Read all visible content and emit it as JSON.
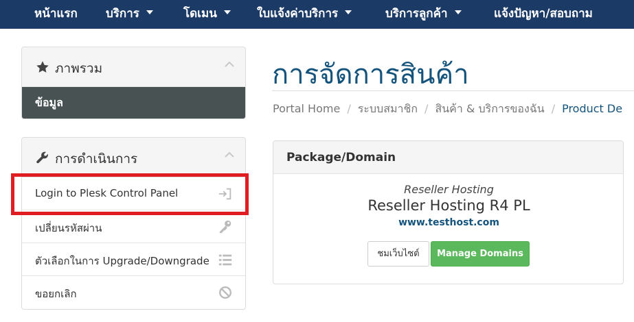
{
  "nav": {
    "items": [
      {
        "label": "หน้าแรก",
        "dropdown": false
      },
      {
        "label": "บริการ",
        "dropdown": true
      },
      {
        "label": "โดเมน",
        "dropdown": true
      },
      {
        "label": "ใบแจ้งค่าบริการ",
        "dropdown": true
      },
      {
        "label": "บริการลูกค้า",
        "dropdown": true
      },
      {
        "label": "แจ้งปัญหา/สอบถาม",
        "dropdown": false
      }
    ]
  },
  "sidebar": {
    "overview": {
      "title": "ภาพรวม",
      "icon": "star-icon",
      "active_item": "ข้อมูล"
    },
    "actions": {
      "title": "การดำเนินการ",
      "icon": "wrench-icon",
      "items": [
        {
          "label": "Login to Plesk Control Panel",
          "icon": "sign-in-icon"
        },
        {
          "label": "เปลี่ยนรหัสผ่าน",
          "icon": "key-icon"
        },
        {
          "label": "ตัวเลือกในการ Upgrade/Downgrade",
          "icon": "list-icon"
        },
        {
          "label": "ขอยกเลิก",
          "icon": "ban-icon"
        }
      ]
    }
  },
  "main": {
    "title": "การจัดการสินค้า",
    "breadcrumb": [
      "Portal Home",
      "ระบบสมาชิก",
      "สินค้า & บริการของฉัน",
      "Product De"
    ],
    "package": {
      "header": "Package/Domain",
      "group": "Reseller Hosting",
      "name": "Reseller Hosting R4 PL",
      "domain": "www.testhost.com",
      "visit_label": "ชมเว็บไซต์",
      "manage_label": "Manage Domains"
    }
  },
  "colors": {
    "navbar": "#1b3a66",
    "accent": "#14537c",
    "active_item": "#485253",
    "success_button": "#5cb85c",
    "highlight_box": "#e11d24"
  }
}
